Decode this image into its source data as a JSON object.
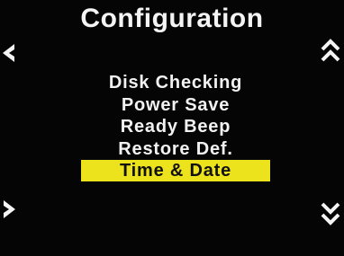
{
  "screen": {
    "title": "Configuration"
  },
  "menu": {
    "items": [
      {
        "label": "Disk Checking",
        "selected": false
      },
      {
        "label": "Power Save",
        "selected": false
      },
      {
        "label": "Ready Beep",
        "selected": false
      },
      {
        "label": "Restore Def.",
        "selected": false
      },
      {
        "label": "Time & Date",
        "selected": true
      }
    ]
  },
  "nav": {
    "left": "chevron-left-icon",
    "right": "chevron-right-icon",
    "up": "double-chevron-up-icon",
    "down": "double-chevron-down-icon"
  },
  "colors": {
    "background": "#050505",
    "text": "#f2f2f2",
    "highlight": "#ece31c",
    "highlight_text": "#111111"
  }
}
